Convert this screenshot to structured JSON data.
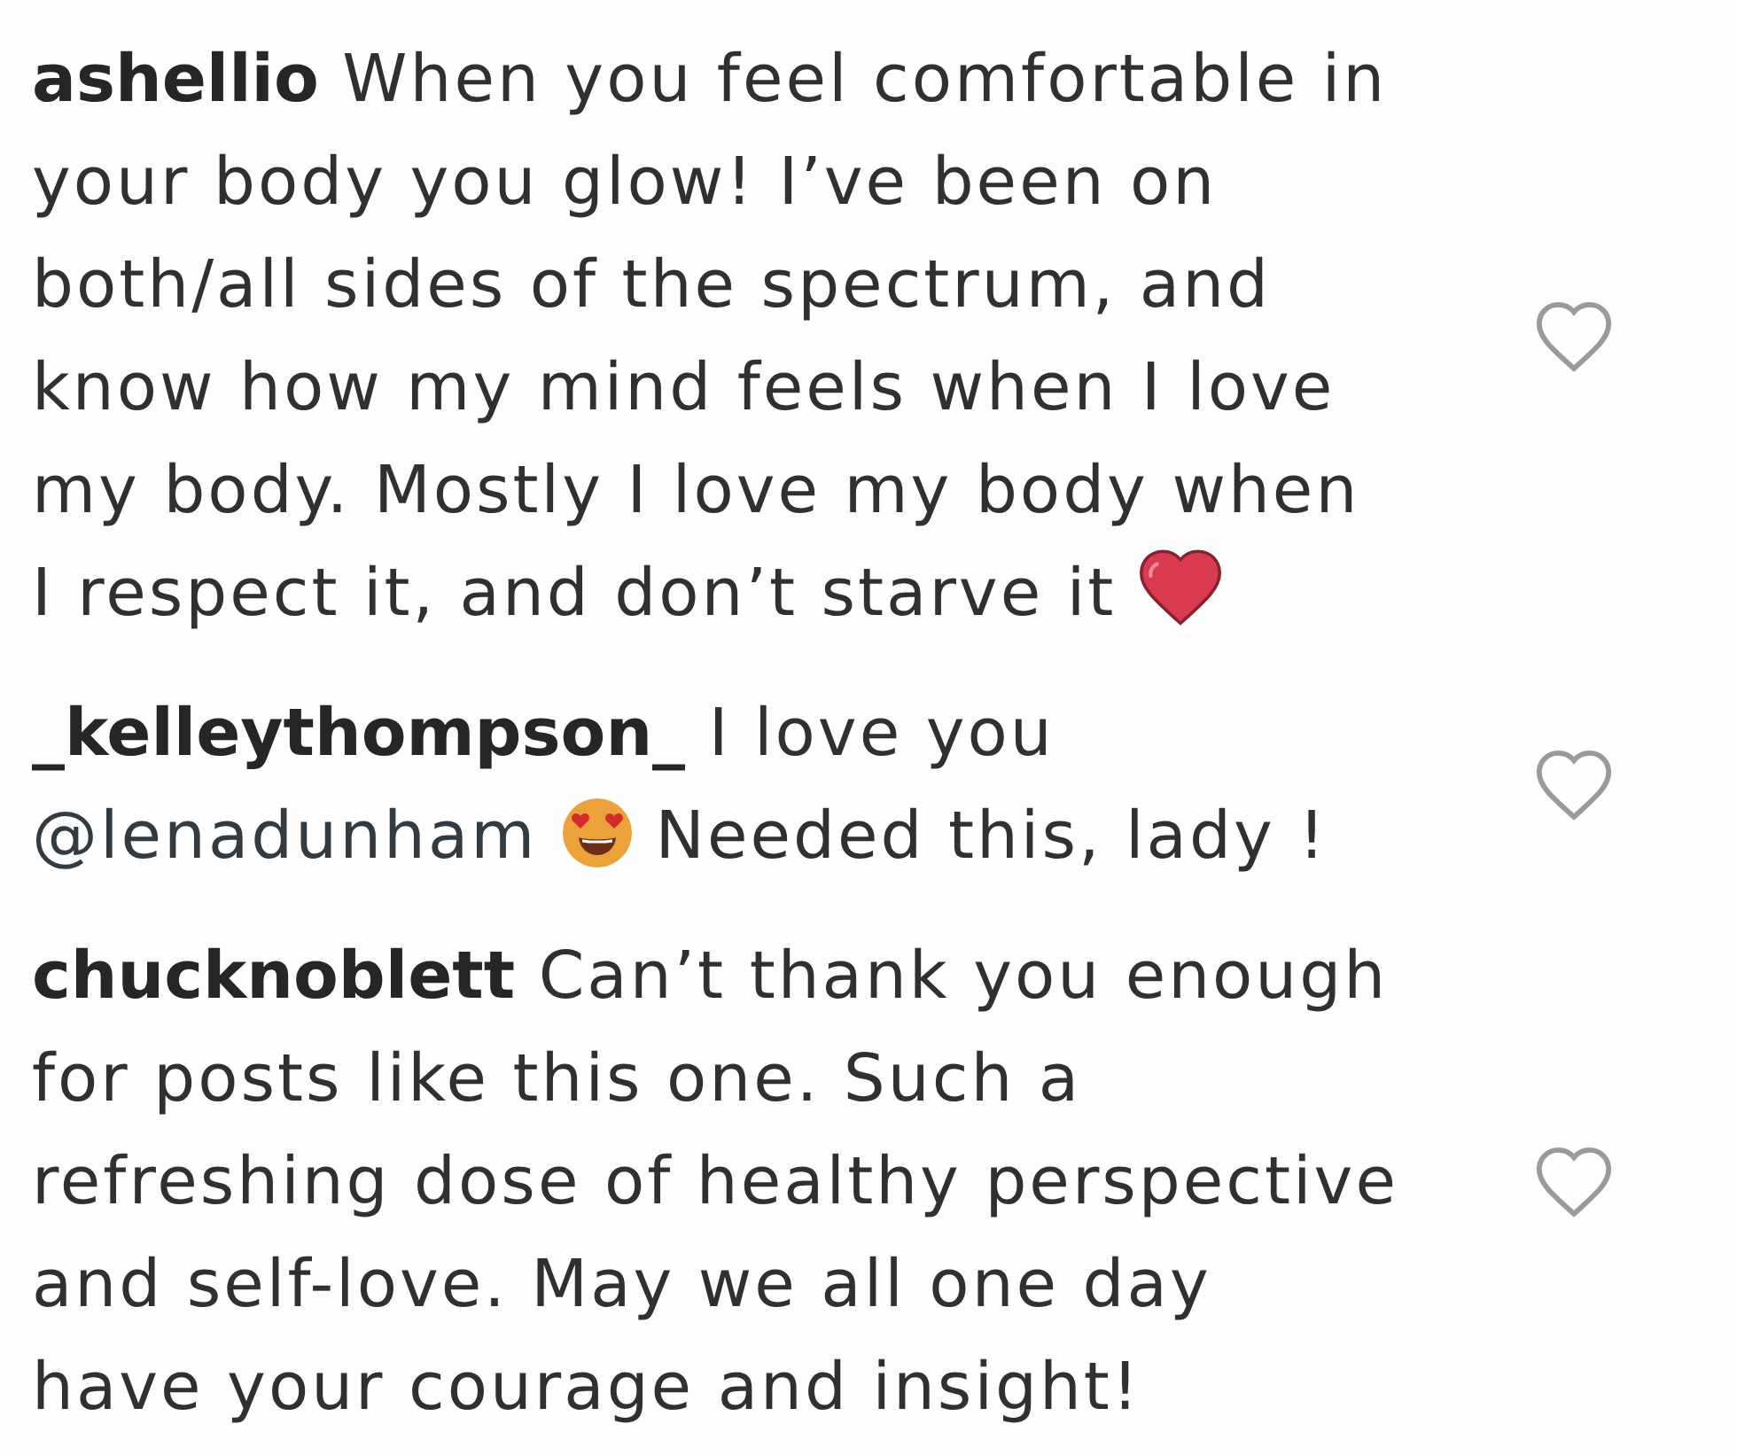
{
  "comments": [
    {
      "username": "ashellio",
      "liked": false,
      "lines": [
        [
          {
            "kind": "text",
            "text": "When you feel comfortable in"
          }
        ],
        [
          {
            "kind": "text",
            "text": "your body you glow! I’ve been on"
          }
        ],
        [
          {
            "kind": "text",
            "text": "both/all sides of the spectrum, and"
          }
        ],
        [
          {
            "kind": "text",
            "text": "know how my mind feels when I love"
          }
        ],
        [
          {
            "kind": "text",
            "text": "my body. Mostly I love my body when"
          }
        ],
        [
          {
            "kind": "text",
            "text": "I respect it, and don’t starve it"
          },
          {
            "kind": "heart_emoji"
          }
        ]
      ]
    },
    {
      "username": "_kelleythompson_",
      "liked": false,
      "lines": [
        [
          {
            "kind": "text",
            "text": "I love you"
          }
        ],
        [
          {
            "kind": "mention",
            "text": "@lenadunham"
          },
          {
            "kind": "heart_eyes_emoji"
          },
          {
            "kind": "text",
            "text": "Needed this, lady !"
          }
        ]
      ]
    },
    {
      "username": "chucknoblett",
      "liked": false,
      "lines": [
        [
          {
            "kind": "text",
            "text": "Can’t thank you enough"
          }
        ],
        [
          {
            "kind": "text",
            "text": "for posts like this one. Such a"
          }
        ],
        [
          {
            "kind": "text",
            "text": "refreshing dose of healthy perspective"
          }
        ],
        [
          {
            "kind": "text",
            "text": "and self-love. May we all one day"
          }
        ],
        [
          {
            "kind": "text",
            "text": "have your courage and insight!"
          }
        ]
      ]
    }
  ]
}
